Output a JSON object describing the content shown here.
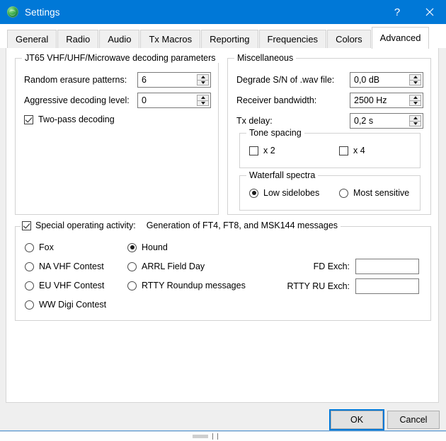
{
  "window": {
    "title": "Settings",
    "icon": "globe-icon",
    "help_label": "?",
    "close_label": "✕",
    "accent_color": "#0078d7"
  },
  "tabs": [
    {
      "label": "General",
      "active": false
    },
    {
      "label": "Radio",
      "active": false
    },
    {
      "label": "Audio",
      "active": false
    },
    {
      "label": "Tx Macros",
      "active": false
    },
    {
      "label": "Reporting",
      "active": false
    },
    {
      "label": "Frequencies",
      "active": false
    },
    {
      "label": "Colors",
      "active": false
    },
    {
      "label": "Advanced",
      "active": true
    }
  ],
  "jt65": {
    "group_title": "JT65 VHF/UHF/Microwave decoding parameters",
    "random_erasure_label": "Random erasure patterns:",
    "random_erasure_value": "6",
    "aggressive_label": "Aggressive decoding level:",
    "aggressive_value": "0",
    "two_pass_label": "Two-pass decoding",
    "two_pass_checked": true
  },
  "misc": {
    "group_title": "Miscellaneous",
    "degrade_label": "Degrade S/N of .wav file:",
    "degrade_value": "0,0 dB",
    "bandwidth_label": "Receiver bandwidth:",
    "bandwidth_value": "2500  Hz",
    "txdelay_label": "Tx delay:",
    "txdelay_value": "0,2  s",
    "tone_spacing": {
      "group_title": "Tone spacing",
      "x2_label": "x 2",
      "x2_checked": false,
      "x4_label": "x 4",
      "x4_checked": false
    },
    "waterfall": {
      "group_title": "Waterfall spectra",
      "low_sidelobes_label": "Low sidelobes",
      "most_sensitive_label": "Most sensitive",
      "selected": "Low sidelobes"
    }
  },
  "special": {
    "checkbox_label": "Special operating activity:",
    "checkbox_checked": true,
    "description": "Generation of FT4, FT8, and MSK144 messages",
    "left_options": [
      {
        "label": "Fox",
        "selected": false
      },
      {
        "label": "NA VHF Contest",
        "selected": false
      },
      {
        "label": "EU VHF Contest",
        "selected": false
      },
      {
        "label": "WW Digi Contest",
        "selected": false
      }
    ],
    "right_options": [
      {
        "label": "Hound",
        "selected": true
      },
      {
        "label": "ARRL Field Day",
        "selected": false
      },
      {
        "label": "RTTY Roundup messages",
        "selected": false
      }
    ],
    "fd_exch_label": "FD Exch:",
    "fd_exch_value": "",
    "rtty_exch_label": "RTTY RU Exch:",
    "rtty_exch_value": ""
  },
  "footer": {
    "ok_label": "OK",
    "cancel_label": "Cancel"
  }
}
